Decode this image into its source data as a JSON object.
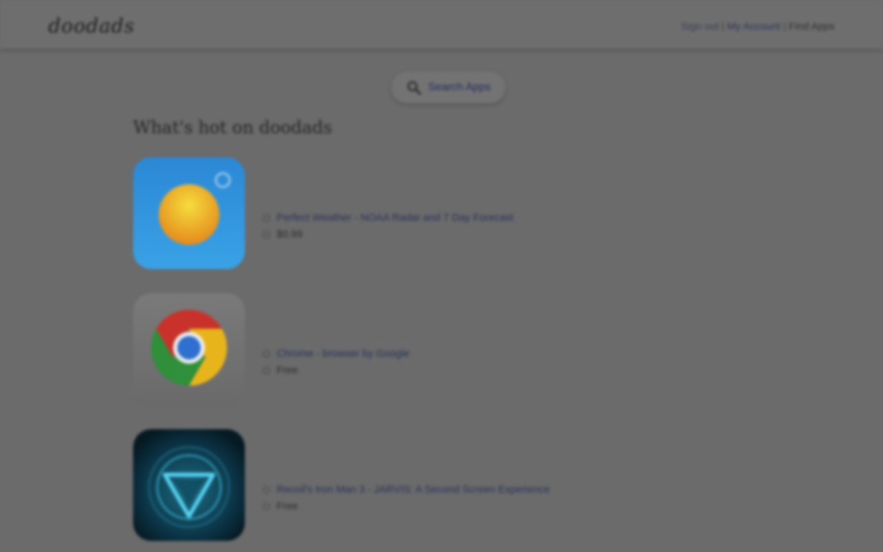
{
  "brand": {
    "logo_text": "doodads"
  },
  "nav": {
    "sign_in": "Sign out",
    "separator": "|",
    "my_account": "My Account",
    "find_apps": "Find Apps"
  },
  "search": {
    "label": "Search Apps",
    "icon": "search-icon"
  },
  "main": {
    "section_title": "What's hot on doodads",
    "apps": [
      {
        "name": "Perfect Weather - NOAA Radar and 7 Day Forecast",
        "price": "$0.99",
        "icon": "weather-sun-icon",
        "icon_color": "#2f8fd8"
      },
      {
        "name": "Chrome - browser by Google",
        "price": "Free",
        "icon": "chrome-icon",
        "icon_color": "#d8d8d8"
      },
      {
        "name": "Recoil's Iron Man 3 - JARVIS: A Second Screen Experience",
        "price": "Free",
        "icon": "jarvis-icon",
        "icon_color": "#0a2a3a"
      }
    ]
  },
  "overlay_color": "#6b6b6b"
}
